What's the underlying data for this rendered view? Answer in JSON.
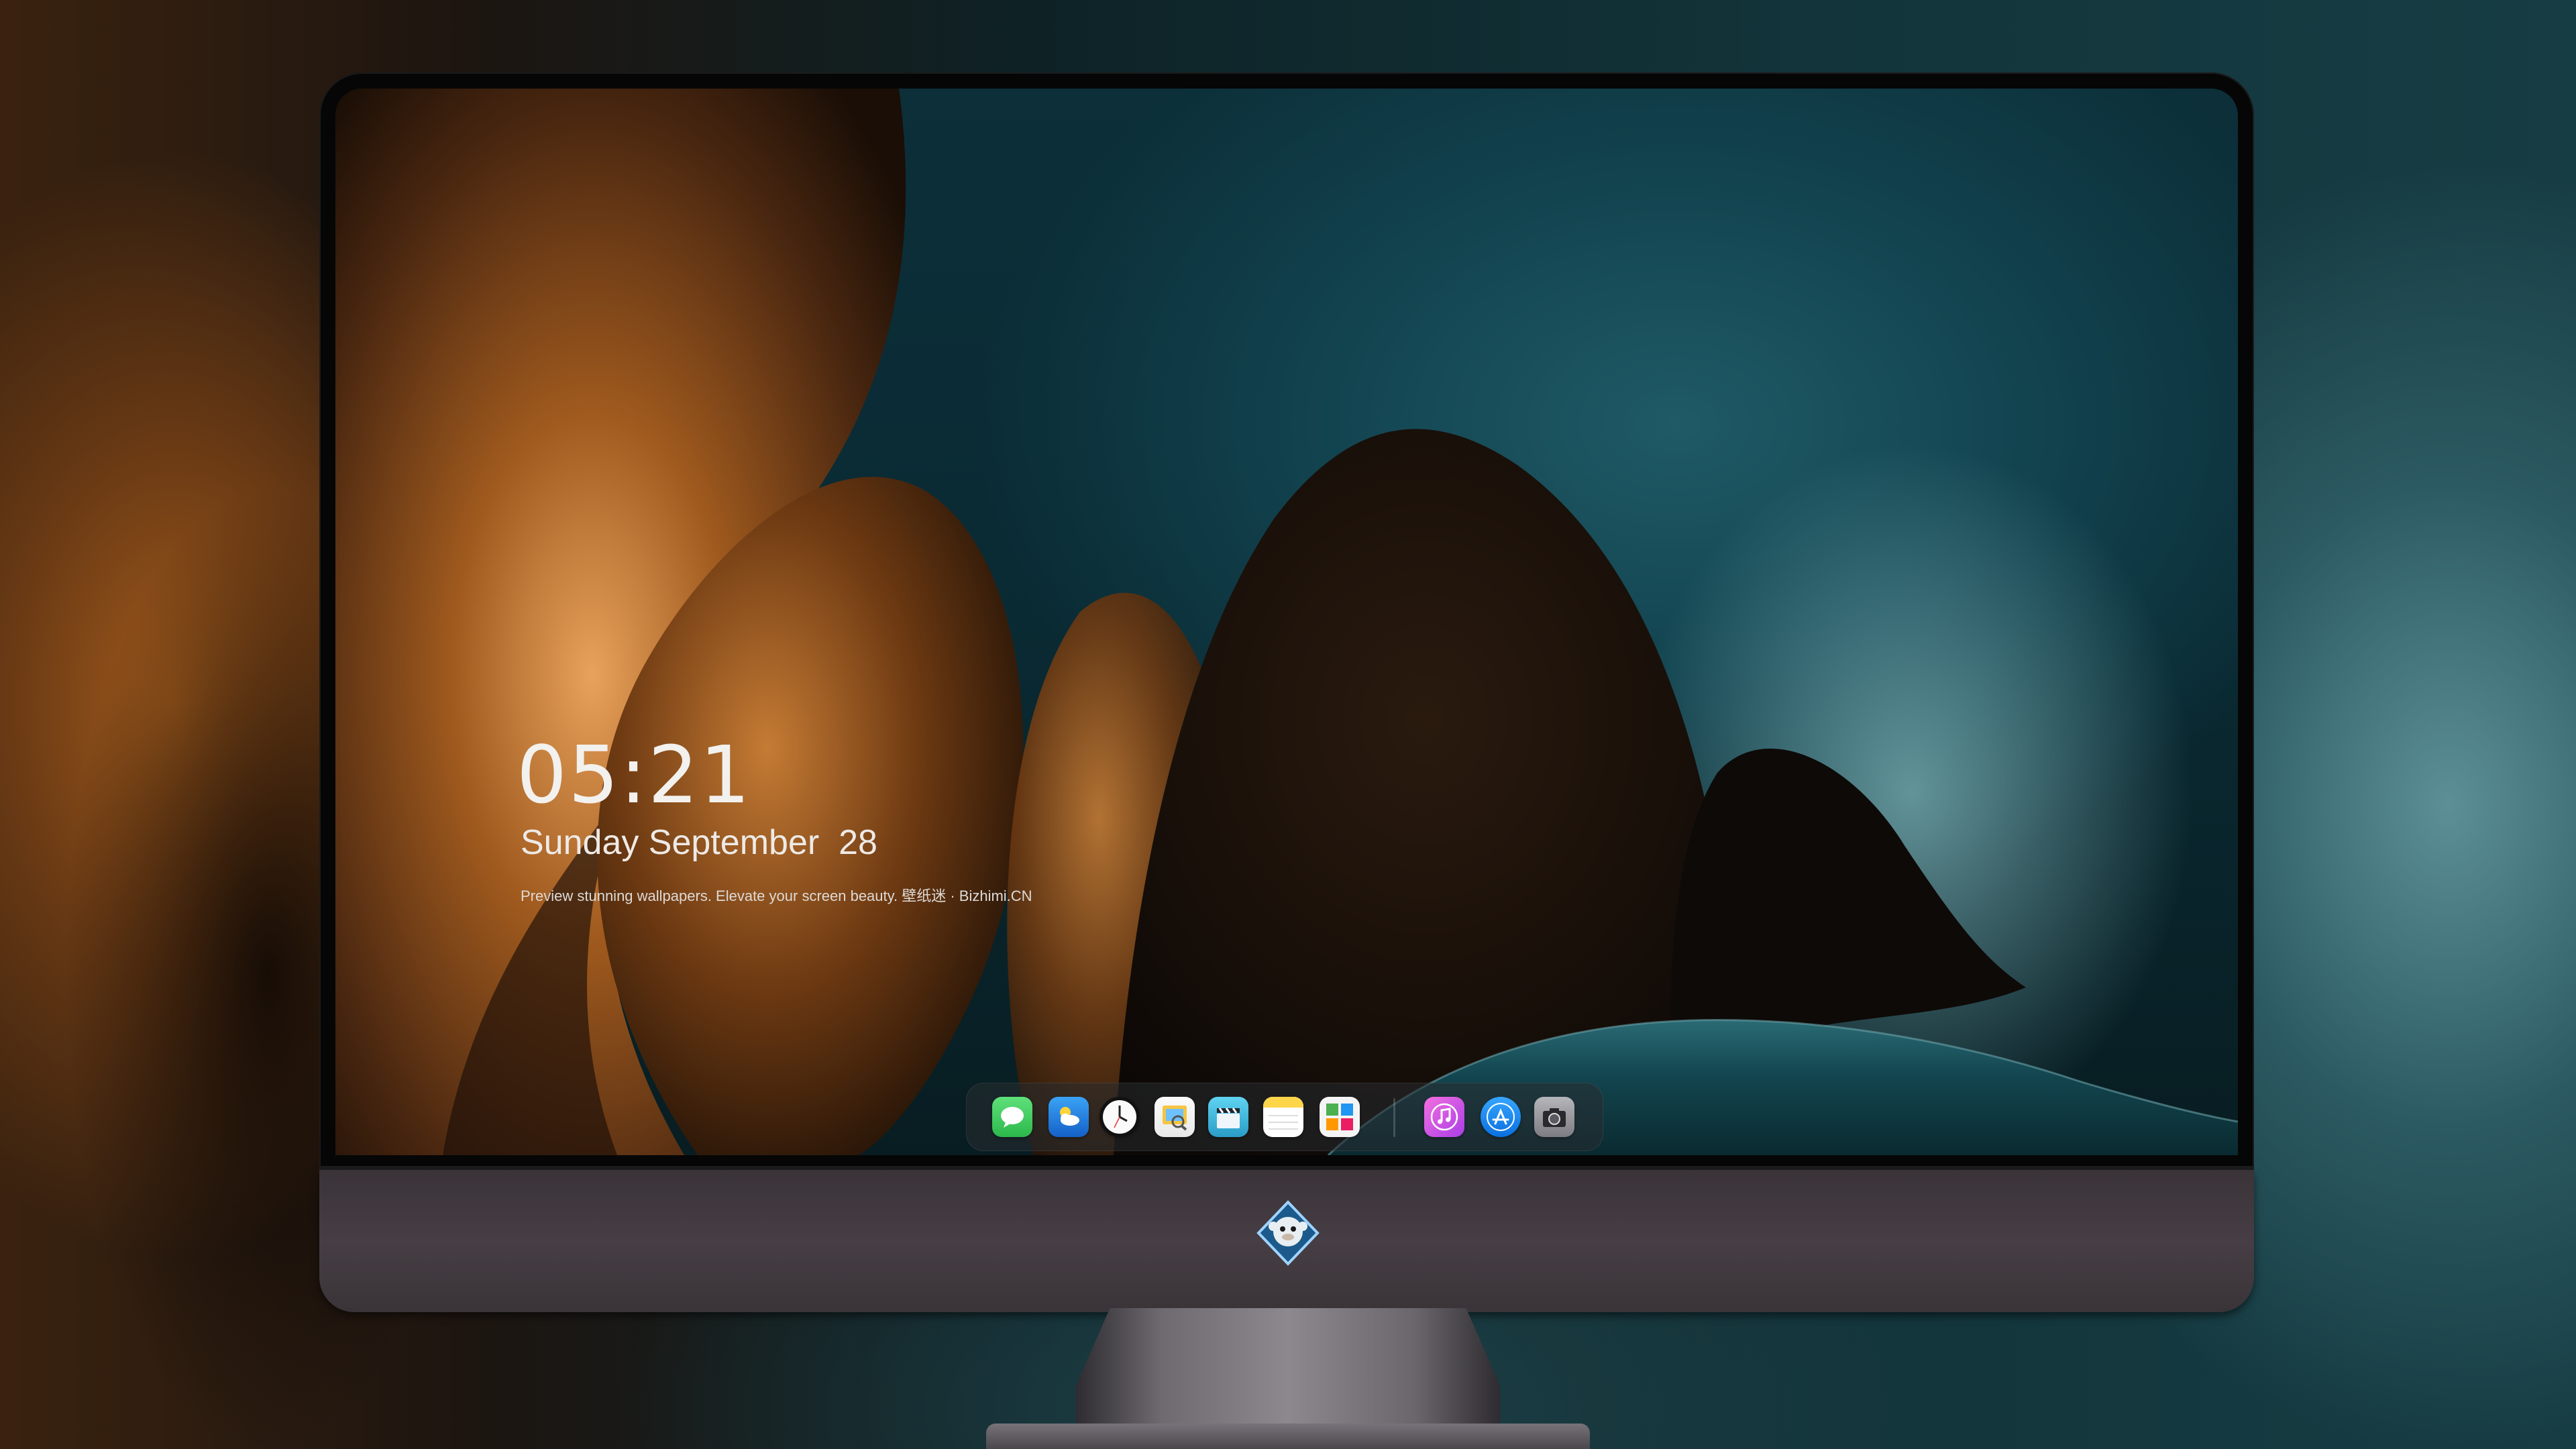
{
  "lockscreen": {
    "time": "05:21",
    "date": "Sunday September  28",
    "tagline": "Preview stunning wallpapers. Elevate your screen beauty. 壁纸迷 · Bizhimi.CN"
  },
  "dock": {
    "apps": [
      {
        "name": "Messages",
        "icon": "messages-icon",
        "color": "#34c759"
      },
      {
        "name": "Weather",
        "icon": "weather-icon",
        "color": "#1e88e5"
      },
      {
        "name": "Clock",
        "icon": "clock-icon",
        "color": "#ffffff"
      },
      {
        "name": "Preview",
        "icon": "preview-icon",
        "color": "#f5c542"
      },
      {
        "name": "Clips",
        "icon": "clapperboard-icon",
        "color": "#3fc3e8"
      },
      {
        "name": "Notes",
        "icon": "notes-icon",
        "color": "#ffd54a"
      },
      {
        "name": "Photo Booth",
        "icon": "photo-grid-icon",
        "color": "#ffffff"
      },
      {
        "name": "iTunes",
        "icon": "music-note-icon",
        "color": "#e84ad8"
      },
      {
        "name": "App Store",
        "icon": "app-store-icon",
        "color": "#1a8cff"
      },
      {
        "name": "Camera",
        "icon": "camera-icon",
        "color": "#8e8e93"
      }
    ]
  },
  "brand": {
    "logo": "monkey-logo-icon"
  }
}
